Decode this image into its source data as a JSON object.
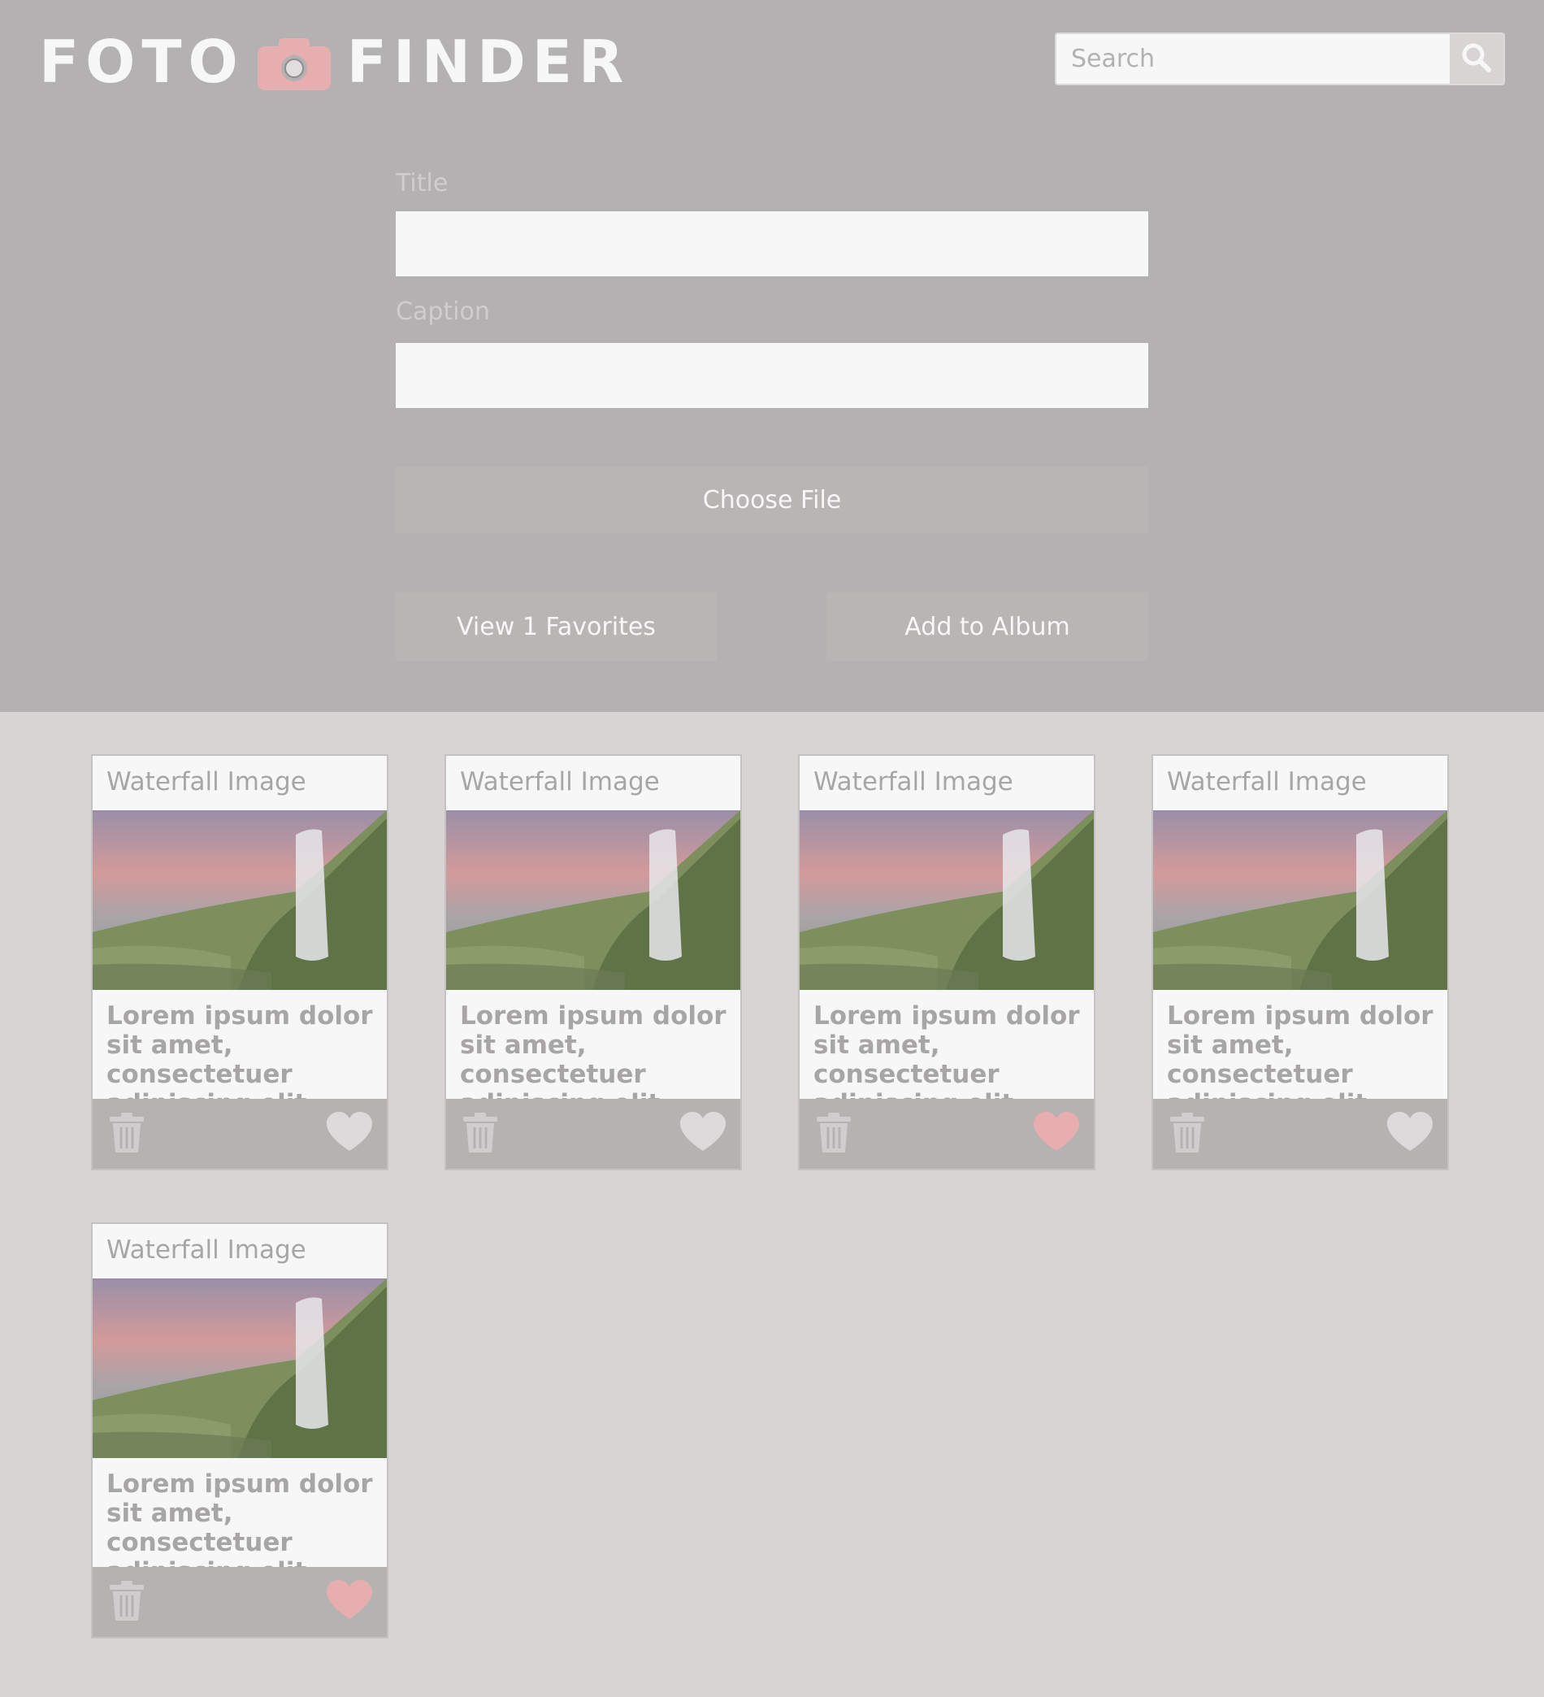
{
  "header": {
    "logo": {
      "left": "FOTO",
      "right": "FINDER"
    },
    "search": {
      "placeholder": "Search"
    }
  },
  "form": {
    "title_label": "Title",
    "title_value": "",
    "caption_label": "Caption",
    "caption_value": "",
    "choose_file_label": "Choose File",
    "view_favorites_label": "View 1 Favorites",
    "add_album_label": "Add to Album"
  },
  "colors": {
    "header_bg": "#b3b1b2",
    "page_bg": "#d9d4d4",
    "accent": "#e6aeae",
    "favorited": "#e6aeae",
    "not_favorited": "#dcdada"
  },
  "cards": [
    {
      "title": "Waterfall Image",
      "caption": "Lorem ipsum dolor sit amet, consectetuer adipiscing elit.",
      "favorite": false
    },
    {
      "title": "Waterfall Image",
      "caption": "Lorem ipsum dolor sit amet, consectetuer adipiscing elit.",
      "favorite": false
    },
    {
      "title": "Waterfall Image",
      "caption": "Lorem ipsum dolor sit amet, consectetuer adipiscing elit.",
      "favorite": true
    },
    {
      "title": "Waterfall Image",
      "caption": "Lorem ipsum dolor sit amet, consectetuer adipiscing elit.",
      "favorite": false
    },
    {
      "title": "Waterfall Image",
      "caption": "Lorem ipsum dolor sit amet, consectetuer adipiscing elit.",
      "favorite": true
    }
  ]
}
